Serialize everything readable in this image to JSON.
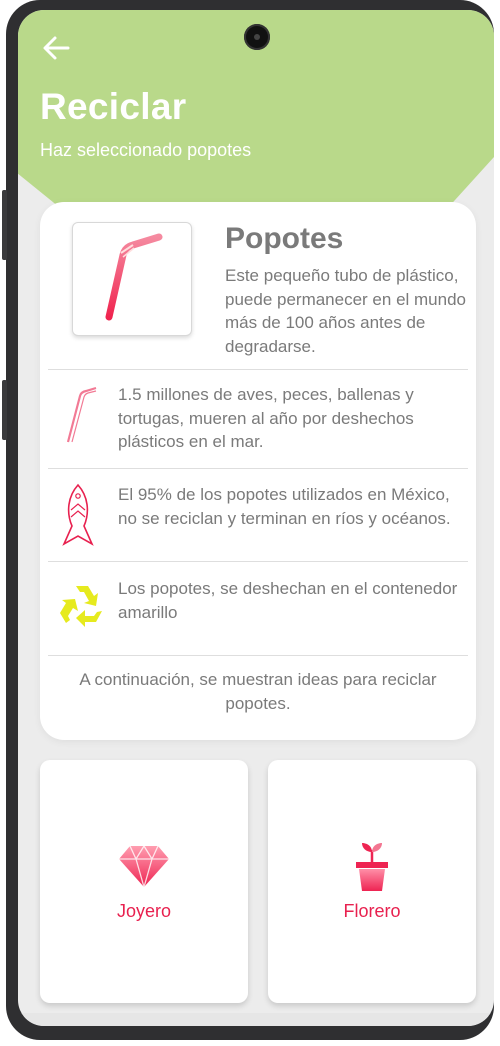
{
  "header": {
    "back_icon": "arrow-left-icon",
    "title": "Reciclar",
    "subtitle": "Haz seleccionado popotes"
  },
  "item": {
    "image_icon": "straw-icon",
    "title": "Popotes",
    "description": "Este pequeño tubo de plástico, puede permanecer en el mundo más de 100 años antes de degradarse."
  },
  "facts": [
    {
      "icon": "straw-icon",
      "text": "1.5 millones de aves, peces, ballenas y tortugas, mueren al año por deshechos plásticos en el mar."
    },
    {
      "icon": "fish-icon",
      "text": "El 95% de los popotes utilizados en México, no se reciclan y terminan en ríos y océanos."
    },
    {
      "icon": "recycle-icon",
      "text": "Los popotes, se deshechan en el contenedor amarillo"
    }
  ],
  "note": "A continuación, se muestran ideas para reciclar popotes.",
  "ideas": [
    {
      "label": "Joyero",
      "icon": "gem-icon"
    },
    {
      "label": "Florero",
      "icon": "flower-pot-icon"
    }
  ],
  "colors": {
    "header_green": "#b9d98a",
    "accent_pink": "#e8214f",
    "recycle_yellow": "#e6ea1e",
    "text_gray": "#7a7a7a"
  }
}
